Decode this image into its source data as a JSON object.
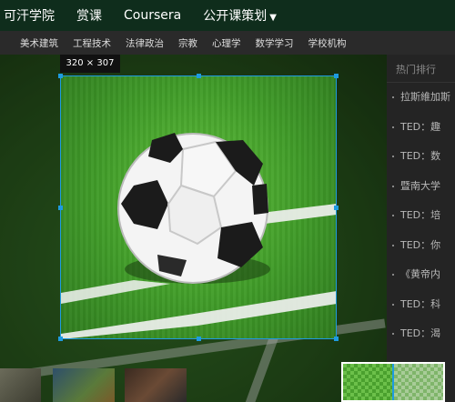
{
  "topnav": {
    "items": [
      {
        "label": "可汗学院"
      },
      {
        "label": "赏课"
      },
      {
        "label": "Coursera"
      },
      {
        "label": "公开课策划"
      }
    ]
  },
  "categories": [
    "美术建筑",
    "工程技术",
    "法律政治",
    "宗教",
    "心理学",
    "数学学习",
    "学校机构"
  ],
  "sidebar": {
    "header": "热门排行",
    "items": [
      "拉斯維加斯",
      "TED：趣",
      "TED：数",
      "暨南大学",
      "TED：培",
      "TED：你",
      "《黄帝内",
      "TED：科",
      "TED：渴"
    ]
  },
  "image": {
    "size_label": "320 × 307",
    "subject": "soccer-ball-on-grass"
  },
  "colors": {
    "accent": "#1e9be0",
    "nav_bg": "#0f2d1c",
    "grass": "#3f9a28"
  }
}
